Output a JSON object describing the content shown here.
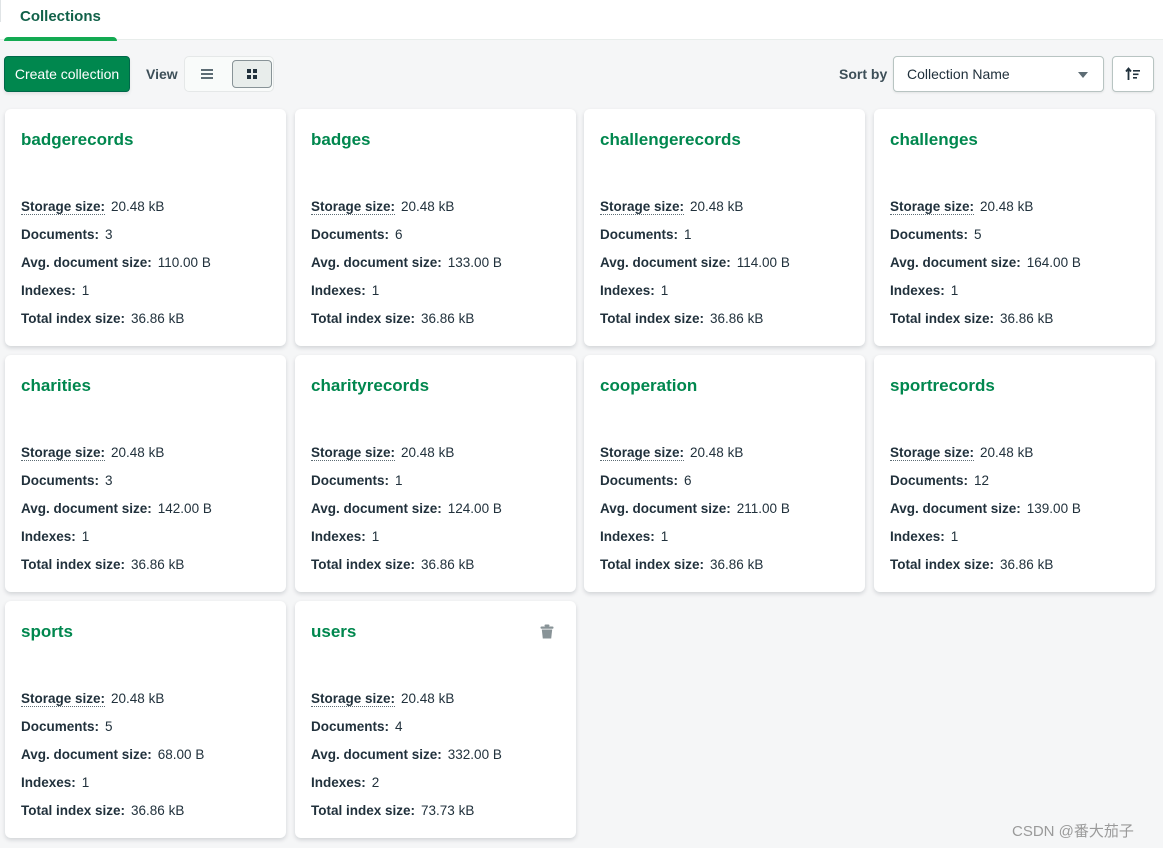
{
  "tabs": [
    {
      "label": "Collections",
      "active": true
    }
  ],
  "toolbar": {
    "create_label": "Create collection",
    "view_label": "View",
    "view_options": [
      {
        "name": "list",
        "icon": "list-icon",
        "selected": false
      },
      {
        "name": "grid",
        "icon": "grid-icon",
        "selected": true
      }
    ],
    "sort_label": "Sort by",
    "sort_value": "Collection Name",
    "sort_direction_icon": "sort-ascending-icon"
  },
  "stat_labels": {
    "storage": "Storage size:",
    "documents": "Documents:",
    "avg": "Avg. document size:",
    "indexes": "Indexes:",
    "total_index": "Total index size:"
  },
  "collections": [
    {
      "name": "badgerecords",
      "storage": "20.48 kB",
      "documents": "3",
      "avg": "110.00 B",
      "indexes": "1",
      "total_index": "36.86 kB"
    },
    {
      "name": "badges",
      "storage": "20.48 kB",
      "documents": "6",
      "avg": "133.00 B",
      "indexes": "1",
      "total_index": "36.86 kB"
    },
    {
      "name": "challengerecords",
      "storage": "20.48 kB",
      "documents": "1",
      "avg": "114.00 B",
      "indexes": "1",
      "total_index": "36.86 kB"
    },
    {
      "name": "challenges",
      "storage": "20.48 kB",
      "documents": "5",
      "avg": "164.00 B",
      "indexes": "1",
      "total_index": "36.86 kB"
    },
    {
      "name": "charities",
      "storage": "20.48 kB",
      "documents": "3",
      "avg": "142.00 B",
      "indexes": "1",
      "total_index": "36.86 kB"
    },
    {
      "name": "charityrecords",
      "storage": "20.48 kB",
      "documents": "1",
      "avg": "124.00 B",
      "indexes": "1",
      "total_index": "36.86 kB"
    },
    {
      "name": "cooperation",
      "storage": "20.48 kB",
      "documents": "6",
      "avg": "211.00 B",
      "indexes": "1",
      "total_index": "36.86 kB"
    },
    {
      "name": "sportrecords",
      "storage": "20.48 kB",
      "documents": "12",
      "avg": "139.00 B",
      "indexes": "1",
      "total_index": "36.86 kB"
    },
    {
      "name": "sports",
      "storage": "20.48 kB",
      "documents": "5",
      "avg": "68.00 B",
      "indexes": "1",
      "total_index": "36.86 kB"
    },
    {
      "name": "users",
      "storage": "20.48 kB",
      "documents": "4",
      "avg": "332.00 B",
      "indexes": "2",
      "total_index": "73.73 kB",
      "hovered": true,
      "action_icon": "trash-icon"
    }
  ],
  "colors": {
    "brand_green": "#00874e",
    "tab_underline": "#13aa52"
  },
  "watermark": "CSDN @番大茄子"
}
